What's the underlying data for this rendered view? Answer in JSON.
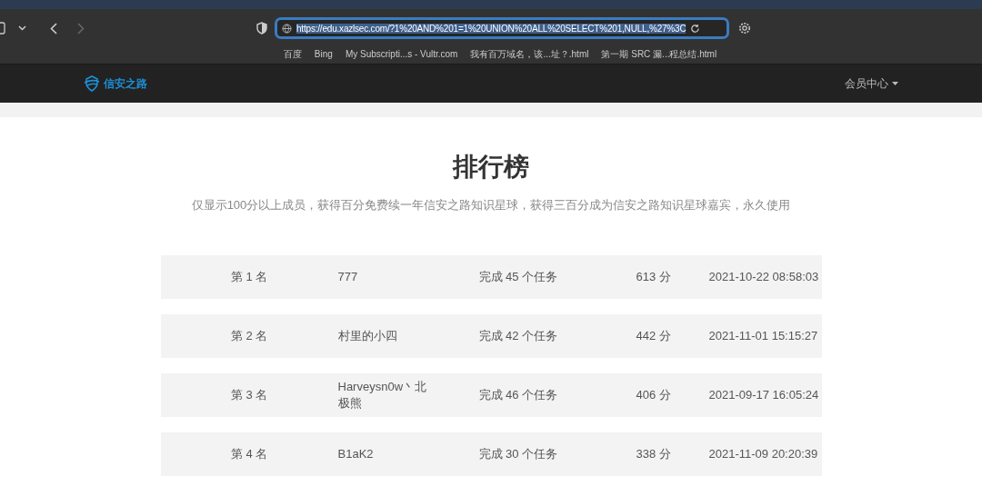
{
  "browser": {
    "url": "https://edu.xazlsec.com/?1%20AND%201=1%20UNION%20ALL%20SELECT%201,NULL,%27%3C",
    "url_selected": true,
    "bookmarks": [
      "百度",
      "Bing",
      "My Subscripti...s - Vultr.com",
      "我有百万域名，该...址？.html",
      "第一期 SRC 漏...程总结.html"
    ]
  },
  "navbar": {
    "logo": "信安之路",
    "menu": "会员中心"
  },
  "title": "排行榜",
  "subtitle": "仅显示100分以上成员，获得百分免费续一年信安之路知识星球，获得三百分成为信安之路知识星球嘉宾，永久使用",
  "rows": [
    {
      "rank": "第 1 名",
      "name": "777",
      "tasks": "完成 45 个任务",
      "score": "613 分",
      "time": "2021-10-22 08:58:03"
    },
    {
      "rank": "第 2 名",
      "name": "村里的小四",
      "tasks": "完成 42 个任务",
      "score": "442 分",
      "time": "2021-11-01 15:15:27"
    },
    {
      "rank": "第 3 名",
      "name": "Harveysn0w丶北极熊",
      "tasks": "完成 46 个任务",
      "score": "406 分",
      "time": "2021-09-17 16:05:24"
    },
    {
      "rank": "第 4 名",
      "name": "B1aK2",
      "tasks": "完成 30 个任务",
      "score": "338 分",
      "time": "2021-11-09 20:20:39"
    }
  ]
}
